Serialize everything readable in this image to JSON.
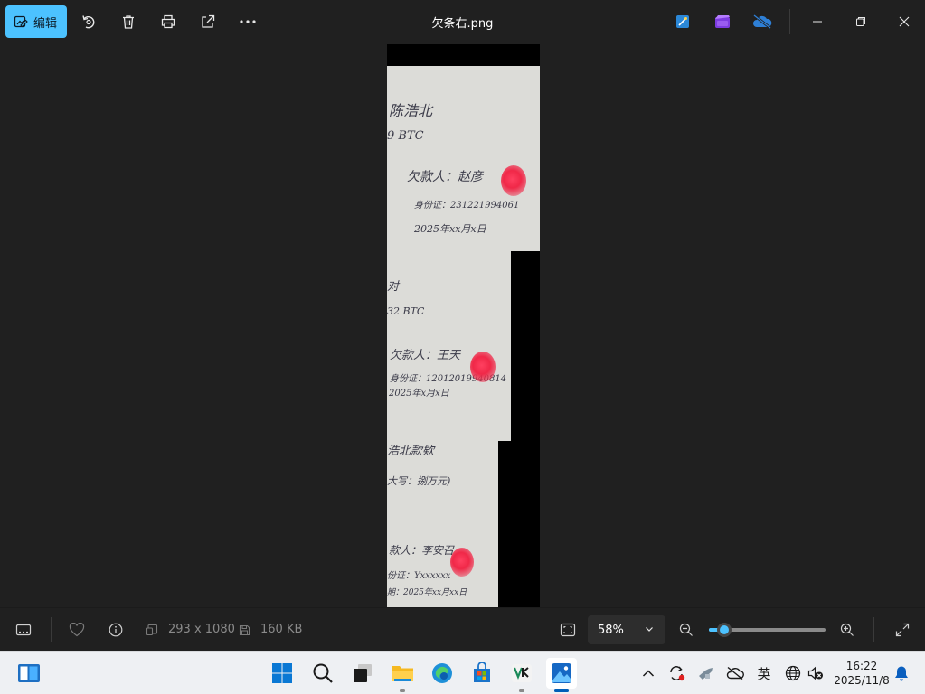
{
  "toolbar": {
    "edit_label": "编辑",
    "title": "欠条右.png"
  },
  "image": {
    "page1": {
      "line1": "陈浩北",
      "line2": "9 BTC",
      "line3": "欠款人：赵彦",
      "line4": "身份证：231221994061",
      "line5": "2025年xx月x日"
    },
    "page2": {
      "line1": "对",
      "line2": "32 BTC",
      "line3": "欠款人：王天",
      "line4": "身份证：12012019940814",
      "line5": "2025年x月x日"
    },
    "page3": {
      "line1": "浩北款欸",
      "line2": "大写：捌万元)",
      "line3": "款人：李安召",
      "line4": "份证：Yxxxxxx",
      "line5": "期：2025年xx月xx日"
    }
  },
  "statusbar": {
    "dimensions": "293 x 1080",
    "filesize": "160 KB",
    "zoom": "58%",
    "zoom_fraction": 0.13
  },
  "taskbar": {
    "ime": "英",
    "time": "16:22",
    "date": "2025/11/8"
  },
  "colors": {
    "accent": "#4cc2ff",
    "background": "#202020",
    "taskbar": "#eef0f3"
  }
}
